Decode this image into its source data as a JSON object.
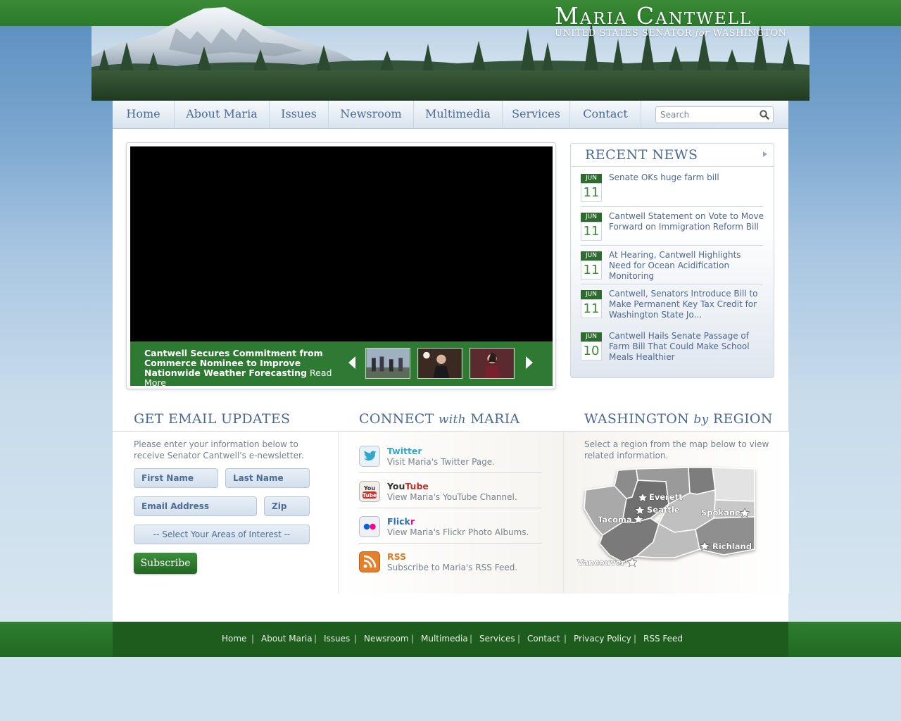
{
  "site": {
    "title": "Maria Cantwell",
    "subtitle_pre": "UNITED STATES SENATOR ",
    "subtitle_for": "for",
    "subtitle_post": " WASHINGTON"
  },
  "nav": {
    "items": [
      "Home",
      "About Maria",
      "Issues",
      "Newsroom",
      "Multimedia",
      "Services",
      "Contact"
    ]
  },
  "search": {
    "placeholder": "Search"
  },
  "slider": {
    "caption": "Cantwell Secures Commitment from Commerce Nominee to Improve Nationwide Weather Forecasting",
    "read_more": "Read More"
  },
  "recent_news": {
    "heading": "RECENT NEWS",
    "items": [
      {
        "month": "JUN",
        "day": "11",
        "title": "Senate OKs huge farm bill"
      },
      {
        "month": "JUN",
        "day": "11",
        "title": "Cantwell Statement on Vote to Move Forward on Immigration Reform Bill"
      },
      {
        "month": "JUN",
        "day": "11",
        "title": "At Hearing, Cantwell Highlights Need for Ocean Acidification Monitoring"
      },
      {
        "month": "JUN",
        "day": "11",
        "title": "Cantwell, Senators Introduce Bill to Make Permanent Key Tax Credit for Washington State Jo..."
      },
      {
        "month": "JUN",
        "day": "10",
        "title": "Cantwell Hails Senate Passage of Farm Bill That Could Make School Meals Healthier"
      }
    ]
  },
  "email": {
    "heading": "GET EMAIL UPDATES",
    "intro": "Please enter your information below to receive Senator Cantwell's e-newsletter.",
    "first_name_placeholder": "First Name",
    "last_name_placeholder": "Last Name",
    "email_placeholder": "Email Address",
    "zip_placeholder": "Zip",
    "interest_select": "-- Select Your Areas of Interest --",
    "subscribe": "Subscribe"
  },
  "connect": {
    "heading_pre": "CONNECT ",
    "heading_with": "with",
    "heading_post": " MARIA",
    "items": [
      {
        "name": "Twitter",
        "desc": "Visit Maria's Twitter Page.",
        "icon": "twitter-icon"
      },
      {
        "name_a": "You",
        "name_b": "Tube",
        "desc": "View Maria's YouTube Channel.",
        "icon": "youtube-icon"
      },
      {
        "name_a": "Flick",
        "name_b": "r",
        "desc": "View Maria's Flickr Photo Albums.",
        "icon": "flickr-icon"
      },
      {
        "name": "RSS",
        "desc": "Subscribe to Maria's RSS Feed.",
        "icon": "rss-icon"
      }
    ]
  },
  "region": {
    "heading_pre": "WASHINGTON ",
    "heading_by": "by",
    "heading_post": " REGION",
    "intro": "Select a region from the map below to view related information.",
    "cities": [
      "Everett",
      "Seattle",
      "Tacoma",
      "Spokane",
      "Richland",
      "Vancouver"
    ]
  },
  "footer": {
    "links": [
      "Home",
      "About Maria",
      "Issues",
      "Newsroom",
      "Multimedia",
      "Services",
      "Contact",
      "Privacy Policy",
      "RSS Feed"
    ],
    "separator": "|"
  },
  "colors": {
    "brand_green": "#2e7a32",
    "link_blue": "#4e6890",
    "heading_blue": "#4a6a95",
    "twitter": "#33a6cc",
    "youtube_red": "#c4302b",
    "flickr_blue": "#0063dc",
    "flickr_pink": "#ff0084",
    "rss_orange": "#e07a22"
  }
}
